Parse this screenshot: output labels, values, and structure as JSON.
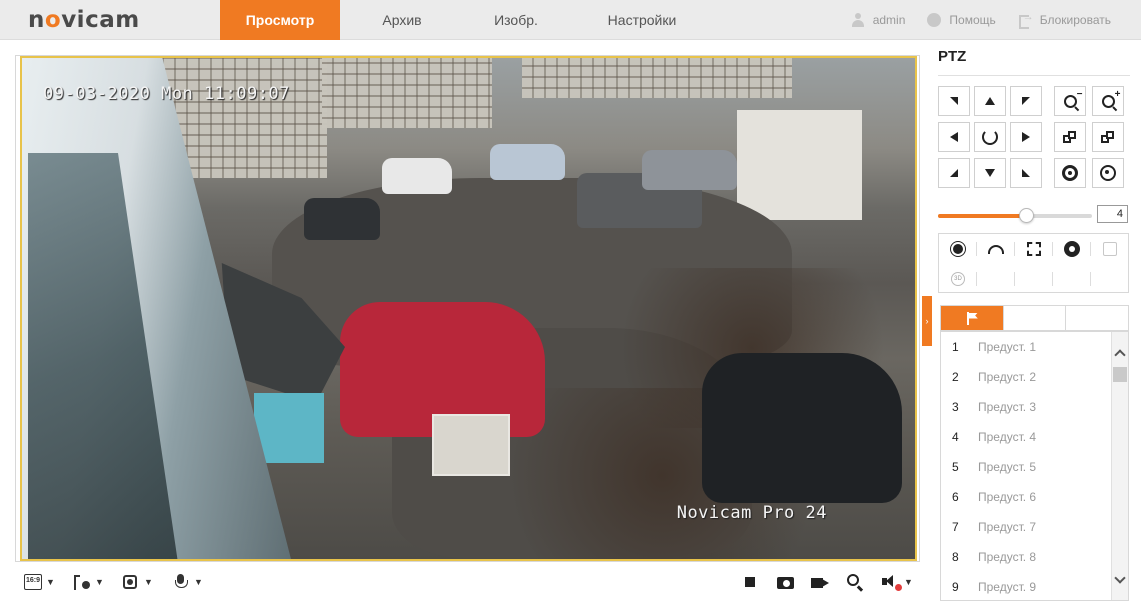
{
  "brand": {
    "logo_text": "novicam",
    "accent": "#f07a22"
  },
  "nav": {
    "tabs": [
      {
        "label": "Просмотр",
        "active": true
      },
      {
        "label": "Архив",
        "active": false
      },
      {
        "label": "Изобр.",
        "active": false
      },
      {
        "label": "Настройки",
        "active": false
      }
    ],
    "user": "admin",
    "help": "Помощь",
    "lock": "Блокировать"
  },
  "video": {
    "osd_timestamp": "09-03-2020 Mon 11:09:07",
    "osd_camera_name": "Novicam Pro 24"
  },
  "video_toolbar": {
    "aspect_label": "16:9",
    "left_icons": [
      "aspect-ratio-icon",
      "stream-select-icon",
      "capture-mode-icon",
      "microphone-icon"
    ],
    "right_icons": [
      "stop-icon",
      "snapshot-icon",
      "record-icon",
      "digital-zoom-icon",
      "volume-muted-icon"
    ]
  },
  "ptz": {
    "title": "PTZ",
    "speed_value": "4",
    "speed_max": 7,
    "directions": [
      "up-left",
      "up",
      "up-right",
      "left",
      "auto",
      "right",
      "down-left",
      "down",
      "down-right"
    ],
    "functions_row1": [
      "light-icon",
      "wiper-icon",
      "menu-icon",
      "home-position-icon",
      "manual-track-icon"
    ],
    "functions_row2": [
      "3d-positioning-icon"
    ]
  },
  "presets": {
    "tabs": [
      "presets-tab",
      "patrol-tab",
      "pattern-tab"
    ],
    "items": [
      {
        "num": "1",
        "label": "Предуст. 1"
      },
      {
        "num": "2",
        "label": "Предуст. 2"
      },
      {
        "num": "3",
        "label": "Предуст. 3"
      },
      {
        "num": "4",
        "label": "Предуст. 4"
      },
      {
        "num": "5",
        "label": "Предуст. 5"
      },
      {
        "num": "6",
        "label": "Предуст. 6"
      },
      {
        "num": "7",
        "label": "Предуст. 7"
      },
      {
        "num": "8",
        "label": "Предуст. 8"
      },
      {
        "num": "9",
        "label": "Предуст. 9"
      }
    ]
  }
}
